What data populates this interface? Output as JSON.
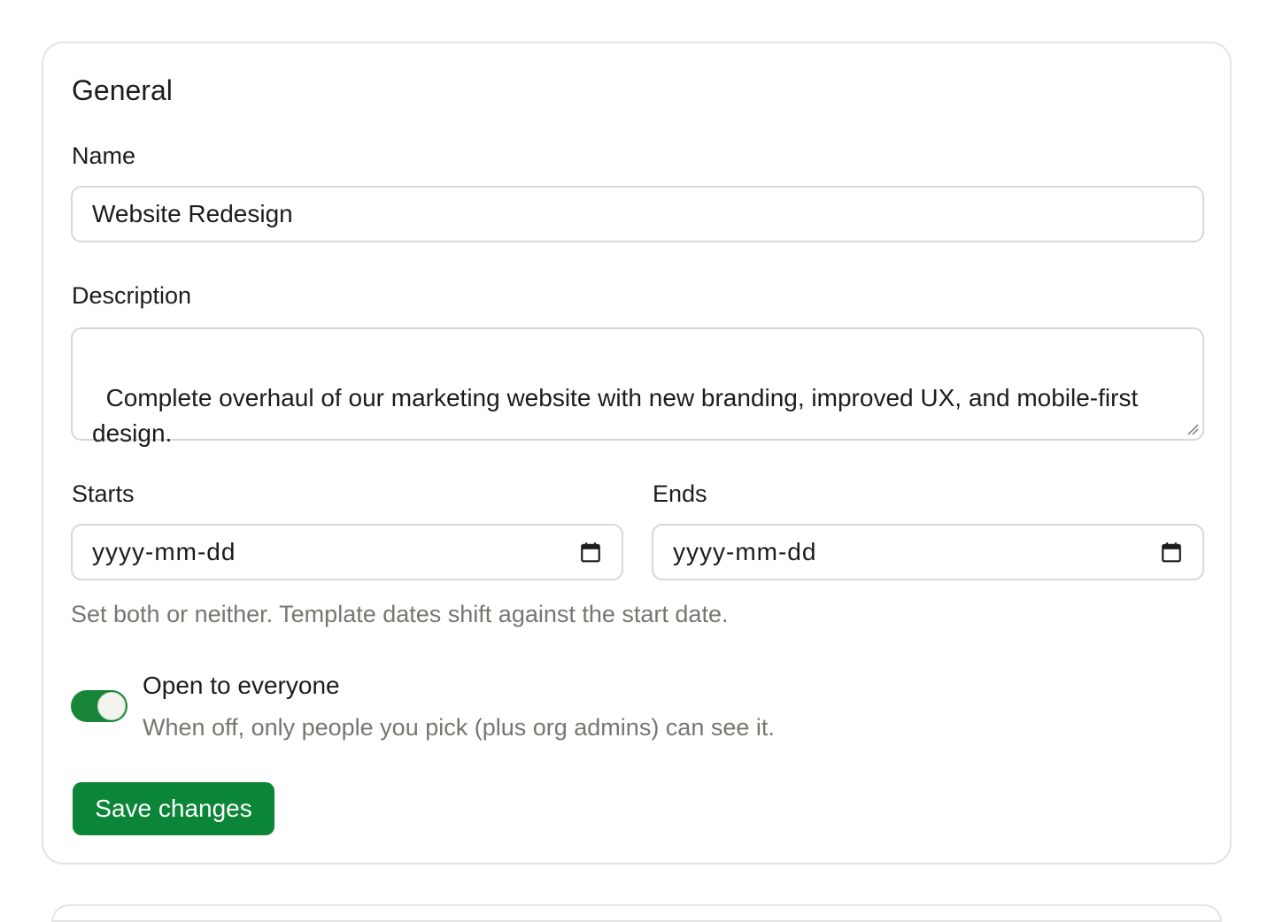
{
  "section": {
    "title": "General"
  },
  "name_field": {
    "label": "Name",
    "value": "Website Redesign"
  },
  "description_field": {
    "label": "Description",
    "value": "Complete overhaul of our marketing website with new branding, improved UX, and mobile-first design."
  },
  "starts_field": {
    "label": "Starts",
    "placeholder": "yyyy-mm-dd",
    "icon": "calendar-icon"
  },
  "ends_field": {
    "label": "Ends",
    "placeholder": "yyyy-mm-dd",
    "icon": "calendar-icon"
  },
  "dates_hint": "Set both or neither. Template dates shift against the start date.",
  "visibility_toggle": {
    "title": "Open to everyone",
    "description": "When off, only people you pick (plus org admins) can see it.",
    "state": "on"
  },
  "save_button": {
    "label": "Save changes"
  },
  "colors": {
    "accent": "#0b8537",
    "muted_text": "#76776c",
    "border": "#d8d8d4"
  }
}
